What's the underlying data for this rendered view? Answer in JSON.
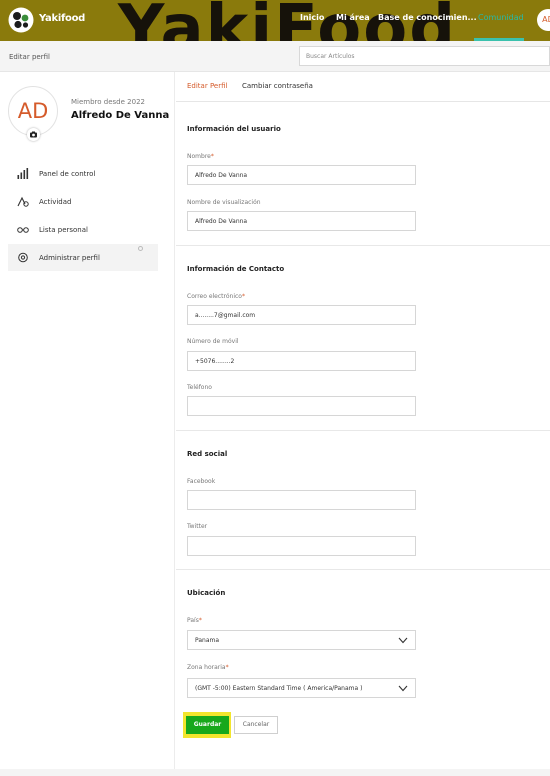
{
  "header": {
    "brand": "Yakifood",
    "watermark": "YakiFood",
    "nav": [
      "Inicio",
      "Mi área",
      "Base de conocimien...",
      "Comunidad"
    ],
    "user_initials": "AD"
  },
  "subbar": {
    "title": "Editar perfil",
    "search_placeholder": "Buscar Artículos"
  },
  "profile": {
    "initials": "AD",
    "member_since": "Miembro desde 2022",
    "name": "Alfredo De Vanna"
  },
  "sidebar": {
    "items": [
      {
        "label": "Panel de control",
        "icon": "bar-chart-icon"
      },
      {
        "label": "Actividad",
        "icon": "activity-icon"
      },
      {
        "label": "Lista personal",
        "icon": "glasses-icon"
      },
      {
        "label": "Administrar perfil",
        "icon": "gear-icon"
      }
    ]
  },
  "tabs": [
    "Editar Perfil",
    "Cambiar contraseña"
  ],
  "user_info": {
    "title": "Información del usuario",
    "name_label": "Nombre",
    "name_value": "Alfredo De Vanna",
    "display_label": "Nombre de visualización",
    "display_value": "Alfredo De Vanna"
  },
  "contact": {
    "title": "Información de Contacto",
    "email_label": "Correo electrónico",
    "email_value": "a........7@gmail.com",
    "mobile_label": "Número de móvil",
    "mobile_value": "+5076........2",
    "phone_label": "Teléfono",
    "phone_value": ""
  },
  "social": {
    "title": "Red social",
    "facebook_label": "Facebook",
    "facebook_value": "",
    "twitter_label": "Twitter",
    "twitter_value": ""
  },
  "location": {
    "title": "Ubicación",
    "country_label": "País",
    "country_value": "Panama",
    "timezone_label": "Zona horaria",
    "timezone_value": "(GMT -5:00) Eastern Standard Time ( America/Panama )"
  },
  "buttons": {
    "save": "Guardar",
    "cancel": "Cancelar"
  },
  "required_mark": "*",
  "colors": {
    "header_bg": "#8a7a0c",
    "accent": "#d55b2b",
    "community": "#28b9a6",
    "save_bg": "#17a81b",
    "save_highlight": "#f2e52d"
  }
}
